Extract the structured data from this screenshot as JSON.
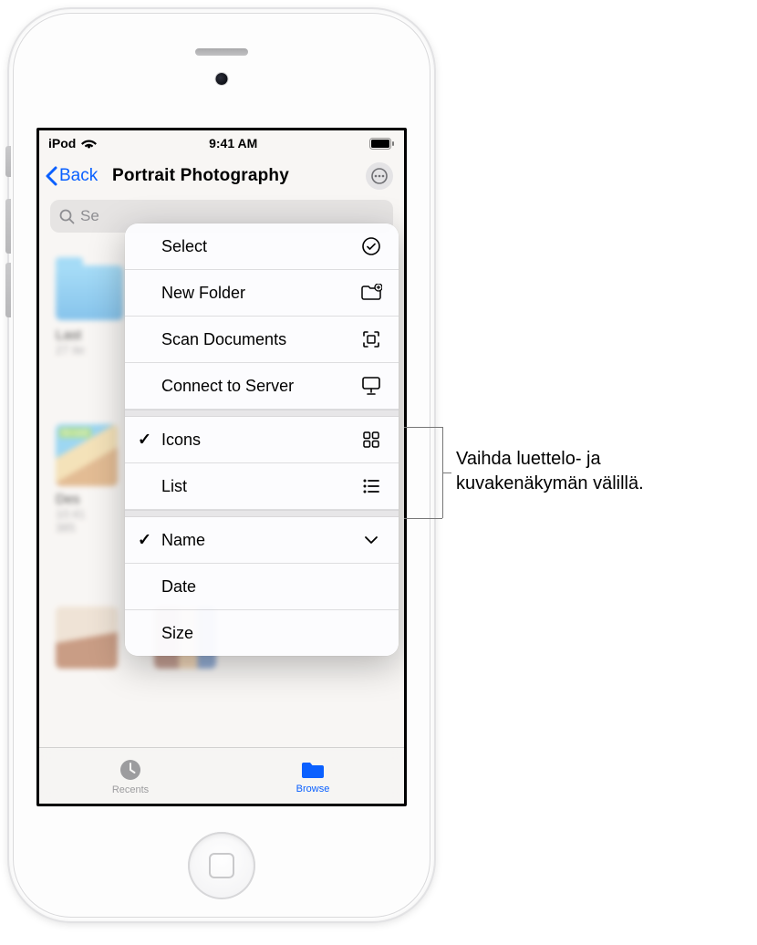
{
  "status": {
    "carrier": "iPod",
    "time": "9:41 AM"
  },
  "nav": {
    "back_label": "Back",
    "title": "Portrait Photography"
  },
  "search": {
    "placeholder": "Search",
    "display": "Se"
  },
  "bg": {
    "folder1": {
      "name": "Last",
      "sub": "27 ite"
    },
    "thumb2": {
      "name": "Des",
      "time": "10:41",
      "size": "385"
    }
  },
  "menu": {
    "select": "Select",
    "new_folder": "New Folder",
    "scan_docs": "Scan Documents",
    "connect_server": "Connect to Server",
    "icons": "Icons",
    "list": "List",
    "name": "Name",
    "date": "Date",
    "size": "Size"
  },
  "tabs": {
    "recents": "Recents",
    "browse": "Browse"
  },
  "callout": {
    "line1": "Vaihda luettelo- ja",
    "line2": "kuvakenäkymän välillä."
  }
}
